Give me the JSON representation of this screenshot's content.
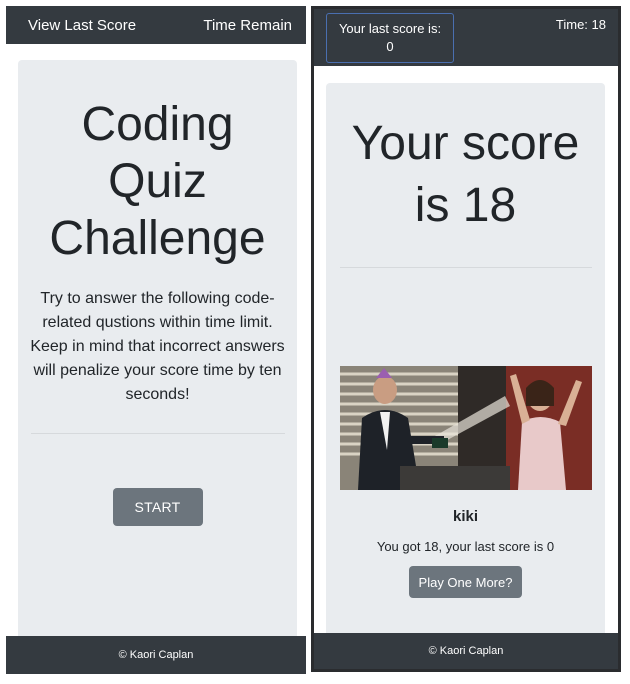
{
  "left": {
    "nav": {
      "view_last_score": "View Last Score",
      "time_remain": "Time Remain"
    },
    "title": "Coding Quiz Challenge",
    "description": "Try to answer the following code-related qustions within time limit. Keep in mind that incorrect answers will penalize your score time by ten seconds!",
    "start_label": "START",
    "footer": "© Kaori Caplan"
  },
  "right": {
    "nav": {
      "last_score_label": "Your last score is:",
      "last_score_value": "0",
      "timer": "Time: 18"
    },
    "score_heading": "Your score is 18",
    "player_name": "kiki",
    "result_text": "You got 18, your last score is 0",
    "play_again_label": "Play One More?",
    "footer": "© Kaori Caplan"
  },
  "colors": {
    "navbar": "#343a40",
    "card": "#e9ecef",
    "button": "#6c757d"
  }
}
